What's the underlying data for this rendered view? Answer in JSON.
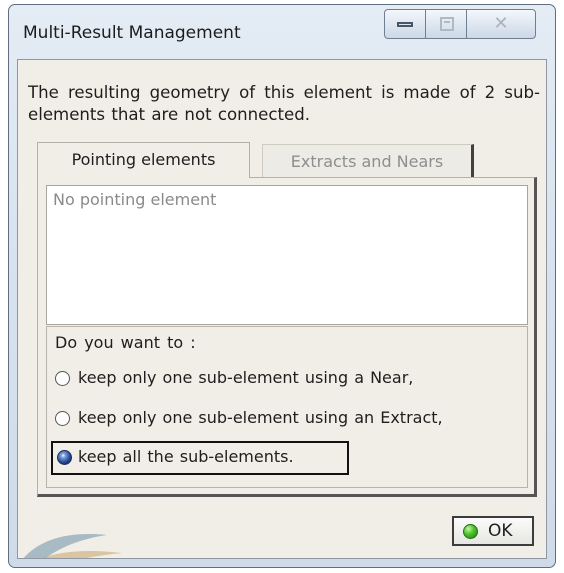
{
  "window": {
    "title": "Multi-Result Management",
    "controls": {
      "minimize": "minimize",
      "maximize": "maximize",
      "close": "close"
    }
  },
  "message": "The resulting geometry of this element is made of 2 sub-elements that are not connected.",
  "tabs": [
    {
      "label": "Pointing elements",
      "active": true
    },
    {
      "label": "Extracts and Nears",
      "active": false
    }
  ],
  "pointing_list": {
    "empty_text": "No pointing element"
  },
  "options": {
    "question": "Do you want to :",
    "choices": [
      {
        "label": "keep only one sub-element using a Near,",
        "checked": false
      },
      {
        "label": "keep only one sub-element using an Extract,",
        "checked": false
      },
      {
        "label": "keep all the sub-elements.",
        "checked": true
      }
    ]
  },
  "ok_button": {
    "label": "OK",
    "icon": "green-circle-icon"
  },
  "colors": {
    "accent_radio": "#21458f",
    "ok_icon": "#4fc92b",
    "dialog_bg": "#f0eee6"
  }
}
